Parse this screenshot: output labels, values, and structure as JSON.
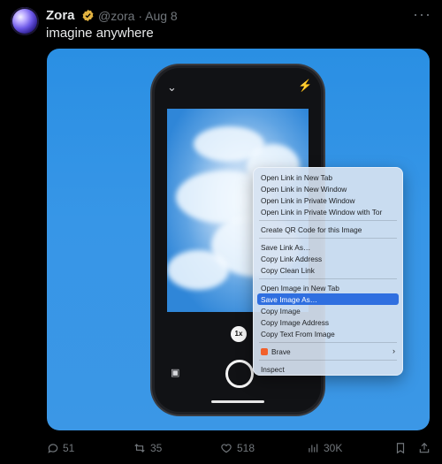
{
  "post": {
    "author_name": "Zora",
    "handle_date": "@zora · Aug 8",
    "more": "···",
    "text": "imagine anywhere"
  },
  "phone": {
    "zoom": "1x"
  },
  "context_menu": {
    "items": [
      "Open Link in New Tab",
      "Open Link in New Window",
      "Open Link in Private Window",
      "Open Link in Private Window with Tor",
      "Create QR Code for this Image",
      "Save Link As…",
      "Copy Link Address",
      "Copy Clean Link",
      "Open Image in New Tab",
      "Save Image As…",
      "Copy Image",
      "Copy Image Address",
      "Copy Text From Image",
      "Brave",
      "Inspect"
    ],
    "selected_index": 9
  },
  "actions": {
    "replies": "51",
    "reposts": "35",
    "likes": "518",
    "views": "30K"
  },
  "colors": {
    "accent": "#2f6fe0",
    "verified": "#e3b341"
  },
  "icons": [
    "verified-badge-icon",
    "more-icon",
    "chevron-down-icon",
    "flash-off-icon",
    "gallery-icon",
    "reply-icon",
    "repost-icon",
    "like-icon",
    "views-icon",
    "bookmark-icon",
    "share-icon"
  ]
}
